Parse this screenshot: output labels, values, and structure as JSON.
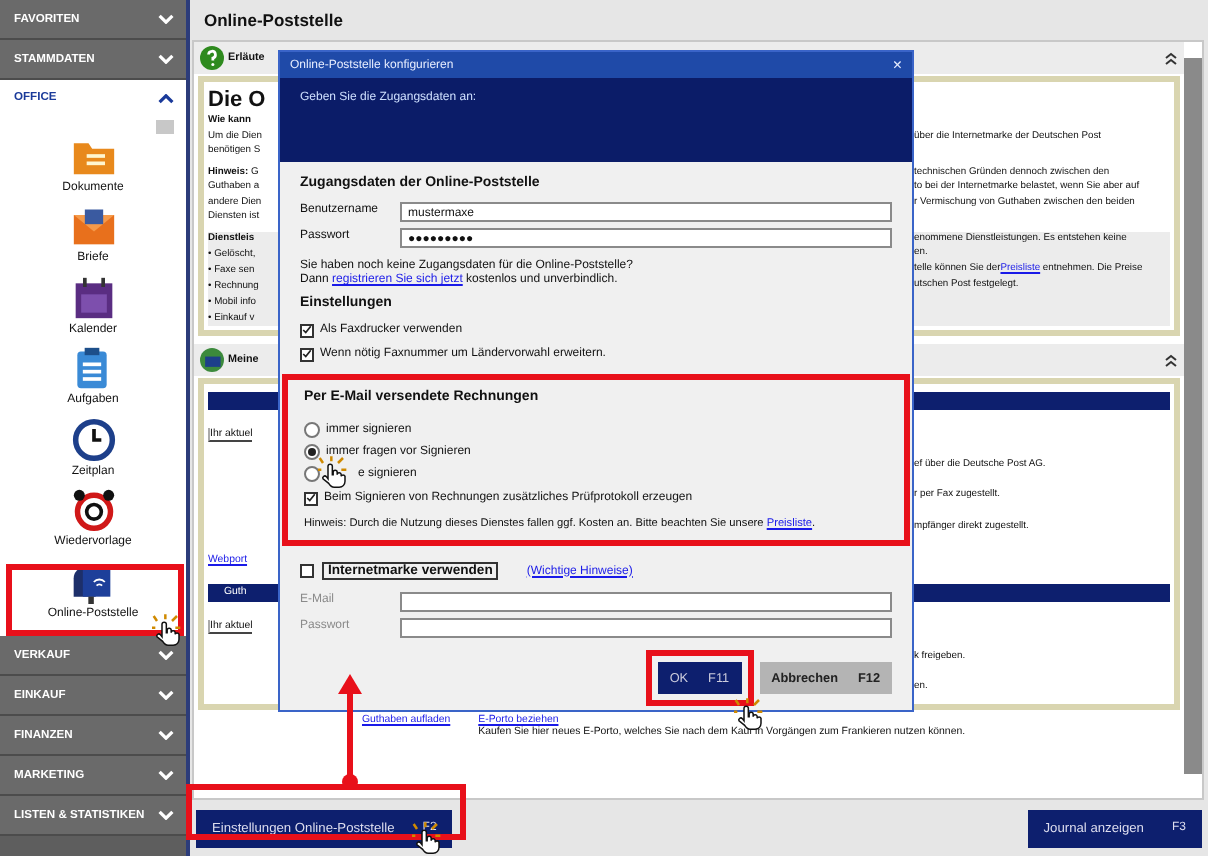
{
  "sidebar": {
    "sections": [
      {
        "label": "FAVORITEN",
        "expanded": false
      },
      {
        "label": "STAMMDATEN",
        "expanded": false
      },
      {
        "label": "OFFICE",
        "expanded": true,
        "items": [
          {
            "label": "Dokumente"
          },
          {
            "label": "Briefe"
          },
          {
            "label": "Kalender"
          },
          {
            "label": "Aufgaben"
          },
          {
            "label": "Zeitplan"
          },
          {
            "label": "Wiedervorlage"
          },
          {
            "label": "Online-Poststelle"
          }
        ]
      },
      {
        "label": "VERKAUF",
        "expanded": false
      },
      {
        "label": "EINKAUF",
        "expanded": false
      },
      {
        "label": "FINANZEN",
        "expanded": false
      },
      {
        "label": "MARKETING",
        "expanded": false
      },
      {
        "label": "LISTEN & STATISTIKEN",
        "expanded": false
      }
    ]
  },
  "page": {
    "title": "Online-Poststelle"
  },
  "panels": [
    {
      "header": "Erläute",
      "rows": [
        {
          "kind": "title",
          "left": "Die O"
        },
        {
          "kind": "bold",
          "left": "Wie kann"
        },
        {
          "kind": "text",
          "left": "Um die Dien",
          "right": "über die Internetmarke der Deutschen Post"
        },
        {
          "kind": "text",
          "left": "benötigen S"
        },
        {
          "kind": "note",
          "left": "**Hinweis:** G",
          "right": "technischen Gründen dennoch zwischen den"
        },
        {
          "kind": "text",
          "left": "Guthaben a",
          "right": "to bei der Internetmarke belastet, wenn Sie aber auf"
        },
        {
          "kind": "text",
          "left": "andere Dien",
          "right": "r Vermischung von Guthaben zwischen den beiden"
        },
        {
          "kind": "text",
          "left": "Diensten ist"
        },
        {
          "kind": "heading",
          "left": "Dienstleis",
          "right": "enommene Dienstleistungen. Es entstehen keine"
        },
        {
          "kind": "bullet",
          "left": "• Gelöscht,",
          "right": "en."
        },
        {
          "kind": "bullet",
          "left": "• Faxe sen",
          "right": "telle können Sie der",
          "link": "Preisliste",
          "right_after": "entnehmen. Die Preise"
        },
        {
          "kind": "bullet",
          "left": "• Rechnung",
          "right": "utschen Post festgelegt."
        },
        {
          "kind": "bullet",
          "left": "• Mobil info"
        },
        {
          "kind": "bullet",
          "left": "• Einkauf v"
        }
      ]
    },
    {
      "header": "Meine",
      "rows": [
        {
          "kind": "bar"
        },
        {
          "kind": "field",
          "left": "Ihr aktuel"
        },
        {
          "kind": "text",
          "right": "ef über die Deutsche Post AG."
        },
        {
          "kind": "text",
          "right": "r per Fax zugestellt."
        },
        {
          "kind": "text",
          "right": "mpfänger direkt zugestellt."
        },
        {
          "kind": "link",
          "left": "Webport"
        },
        {
          "kind": "bar",
          "left": "Guth"
        },
        {
          "kind": "field",
          "left": "Ihr aktuel"
        },
        {
          "kind": "text",
          "right": "k freigeben."
        },
        {
          "kind": "text",
          "right": "en."
        }
      ]
    }
  ],
  "actions": {
    "recharge": "Guthaben aufladen",
    "eporto": "E-Porto beziehen",
    "eporto_text": "Kaufen Sie hier neues E-Porto, welches Sie nach dem Kauf in Vorgängen zum Frankieren nutzen können."
  },
  "dialog": {
    "title": "Online-Poststelle konfigurieren",
    "close": "×",
    "prompt": "Geben Sie die Zugangsdaten an:",
    "access": {
      "heading": "Zugangsdaten der Online-Poststelle",
      "fields": [
        {
          "label": "Benutzername",
          "value": "mustermaxe"
        },
        {
          "label": "Passwort",
          "value": "●●●●●●●●●"
        }
      ],
      "note": "Sie haben noch keine Zugangsdaten für die Online-Poststelle?",
      "note_before": "Dann",
      "note_link": "registrieren Sie sich jetzt",
      "note_after": "kostenlos und unverbindlich."
    },
    "settings": {
      "heading": "Einstellungen",
      "options": [
        {
          "label": "Als Faxdrucker verwenden",
          "checked": true
        },
        {
          "label": "Wenn nötig Faxnummer um Ländervorwahl erweitern.",
          "checked": true
        }
      ]
    },
    "email_invoices": {
      "heading": "Per E-Mail versendete Rechnungen",
      "radios": [
        {
          "label": "immer signieren",
          "selected": false
        },
        {
          "label": "immer fragen vor Signieren",
          "selected": true
        },
        {
          "label": "e signieren",
          "selected": false
        }
      ],
      "protocol": {
        "label": "Beim Signieren von Rechnungen zusätzliches Prüfprotokoll erzeugen",
        "checked": true
      },
      "hint": "Hinweis: Durch die Nutzung dieses Dienstes fallen ggf. Kosten an. Bitte beachten Sie unsere",
      "hint_link": "Preisliste",
      "hint_after": "."
    },
    "internetmarke": {
      "label": "Internetmarke verwenden",
      "checked": false,
      "link": "(Wichtige Hinweise)",
      "disabled": true,
      "fields": [
        {
          "label": "E-Mail"
        },
        {
          "label": "Passwort"
        }
      ]
    },
    "buttons": [
      {
        "label": "OK",
        "key": "F11",
        "kind": "primary"
      },
      {
        "label": "Abbrechen",
        "key": "F12",
        "kind": "secondary"
      }
    ]
  },
  "bottom_bar": {
    "buttons": [
      {
        "label": "Einstellungen Online-Poststelle",
        "key": "F2"
      },
      {
        "label": "Journal anzeigen",
        "key": "F3"
      }
    ]
  }
}
